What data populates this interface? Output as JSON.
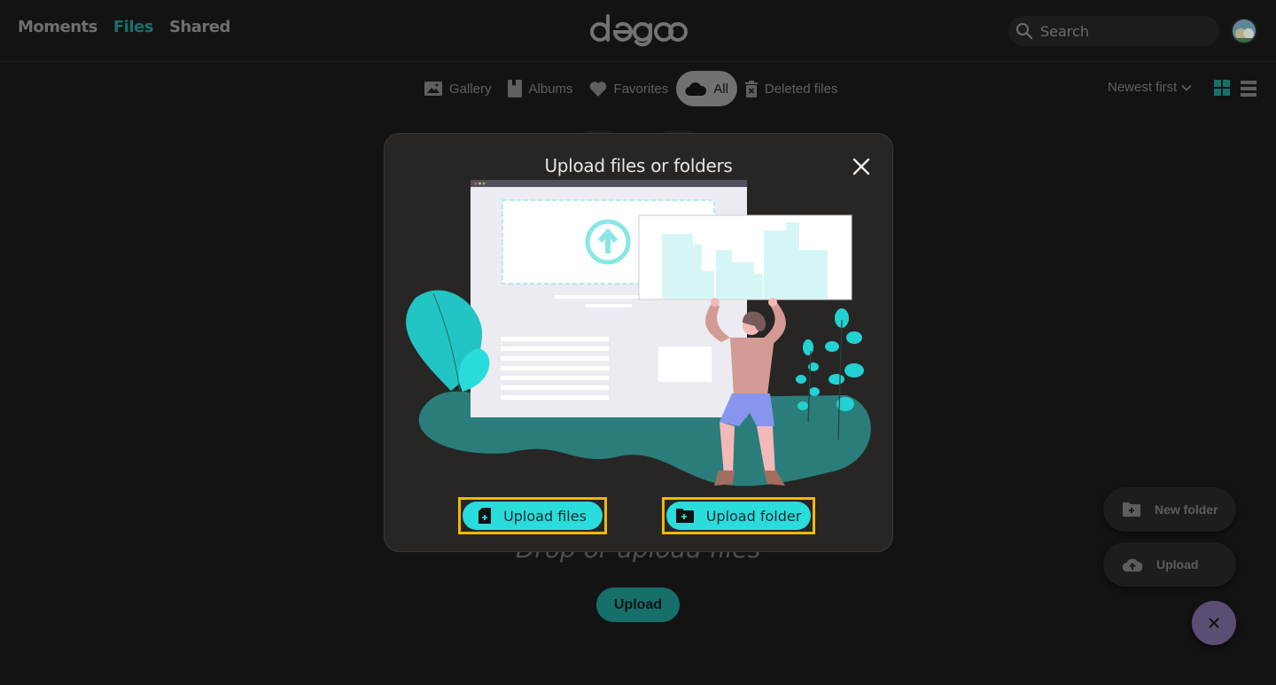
{
  "header": {
    "nav": [
      {
        "label": "Moments",
        "active": false
      },
      {
        "label": "Files",
        "active": true
      },
      {
        "label": "Shared",
        "active": false
      }
    ],
    "logo_text": "degoo",
    "search": {
      "placeholder": "Search",
      "value": ""
    },
    "avatar_icon": "user-avatar"
  },
  "subnav": {
    "tabs": [
      {
        "label": "Gallery",
        "icon": "image-icon",
        "active": false
      },
      {
        "label": "Albums",
        "icon": "album-icon",
        "active": false
      },
      {
        "label": "Favorites",
        "icon": "heart-icon",
        "active": false
      },
      {
        "label": "All",
        "icon": "cloud-icon",
        "active": true
      },
      {
        "label": "Deleted files",
        "icon": "trash-icon",
        "active": false
      }
    ],
    "sort": {
      "selected": "Newest first"
    },
    "view_mode": "grid"
  },
  "background": {
    "drop_text": "Drop or upload files",
    "upload_label": "Upload"
  },
  "fab_menu": {
    "items": [
      {
        "label": "New folder",
        "icon": "folder-plus-icon"
      },
      {
        "label": "Upload",
        "icon": "cloud-upload-icon"
      }
    ],
    "close_icon": "close-icon"
  },
  "modal": {
    "title": "Upload files or folders",
    "upload_files_label": "Upload files",
    "upload_folder_label": "Upload folder"
  },
  "colors": {
    "accent": "#17706c",
    "primary_button": "#2adcdc",
    "highlight_border": "#f2b800",
    "fab": "#5b4e74"
  }
}
